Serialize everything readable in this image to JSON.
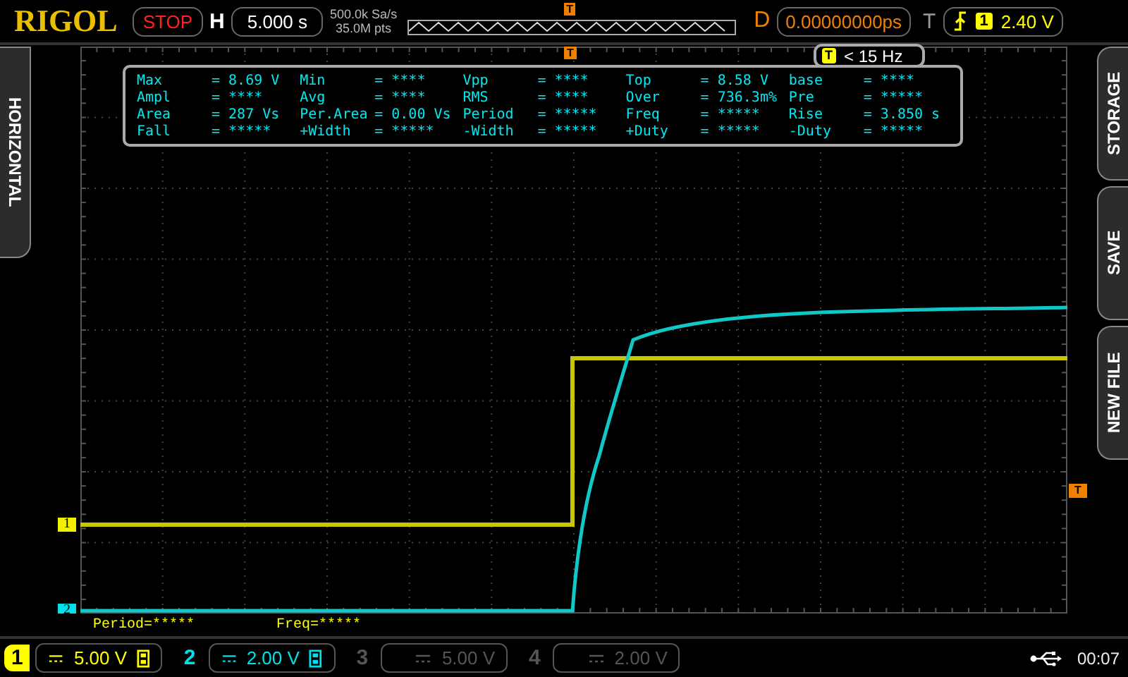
{
  "brand": "RIGOL",
  "run_state": {
    "label": "STOP"
  },
  "horizontal": {
    "label": "H",
    "timebase": "5.000 s",
    "sample_rate": "500.0k Sa/s",
    "memory_depth": "35.0M pts",
    "position_marker": "T"
  },
  "delay": {
    "label": "D",
    "value": "0.00000000ps"
  },
  "trigger": {
    "label": "T",
    "source": "1",
    "level": "2.40 V",
    "badge": "T",
    "frequency": "< 15 Hz",
    "screen_marker": "T",
    "level_marker": "T"
  },
  "side_tabs_left": [
    {
      "label": "HORIZONTAL"
    }
  ],
  "side_tabs_right": [
    {
      "label": "STORAGE"
    },
    {
      "label": "SAVE"
    },
    {
      "label": "NEW FILE"
    }
  ],
  "channel_markers": [
    {
      "label": "1",
      "color": "#f0f000"
    },
    {
      "label": "2",
      "color": "#00e0e8"
    }
  ],
  "measurements": [
    {
      "label": "Max",
      "value": "= 8.69 V"
    },
    {
      "label": "Min",
      "value": "= ****"
    },
    {
      "label": "Vpp",
      "value": "= ****"
    },
    {
      "label": "Top",
      "value": "= 8.58 V"
    },
    {
      "label": "base",
      "value": "= ****"
    },
    {
      "label": "Ampl",
      "value": "= ****"
    },
    {
      "label": "Avg",
      "value": "= ****"
    },
    {
      "label": "RMS",
      "value": "= ****"
    },
    {
      "label": "Over",
      "value": "= 736.3m%"
    },
    {
      "label": "Pre",
      "value": "= *****"
    },
    {
      "label": "Area",
      "value": "= 287 Vs"
    },
    {
      "label": "Per.Area",
      "value": "= 0.00 Vs"
    },
    {
      "label": "Period",
      "value": "= *****"
    },
    {
      "label": "Freq",
      "value": "= *****"
    },
    {
      "label": "Rise",
      "value": "= 3.850 s"
    },
    {
      "label": "Fall",
      "value": "= *****"
    },
    {
      "label": "+Width",
      "value": "= *****"
    },
    {
      "label": "-Width",
      "value": "= *****"
    },
    {
      "label": "+Duty",
      "value": "= *****"
    },
    {
      "label": "-Duty",
      "value": "= *****"
    }
  ],
  "cursor_readouts": [
    "Period=*****",
    "Freq=*****"
  ],
  "channels": [
    {
      "number": "1",
      "scale": "5.00 V",
      "on": true,
      "selected": true,
      "color": "#ffff00"
    },
    {
      "number": "2",
      "scale": "2.00 V",
      "on": true,
      "selected": false,
      "color": "#00e0e8"
    },
    {
      "number": "3",
      "scale": "5.00 V",
      "on": false,
      "selected": false
    },
    {
      "number": "4",
      "scale": "2.00 V",
      "on": false,
      "selected": false
    }
  ],
  "status": {
    "time": "00:07"
  }
}
